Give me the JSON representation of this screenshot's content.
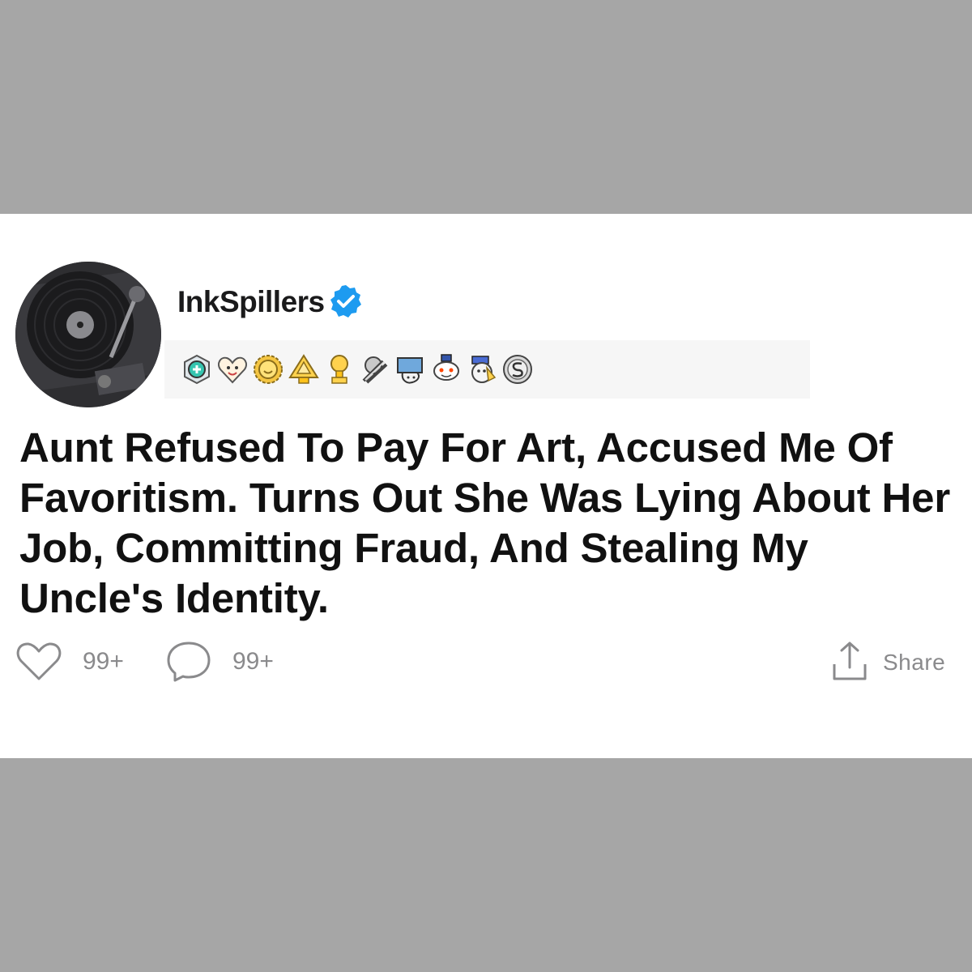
{
  "post": {
    "username": "InkSpillers",
    "verified": true,
    "title": "Aunt Refused To Pay For Art, Accused Me Of Favoritism. Turns Out She Was Lying About Her Job, Committing Fraud, And Stealing My Uncle's Identity.",
    "awards": [
      "helpful-award-icon",
      "wholesome-award-icon",
      "silver-sun-award-icon",
      "take-my-energy-award-icon",
      "gold-trophy-award-icon",
      "hugz-award-icon",
      "wholesome-seal-award-icon",
      "snoo-award-icon",
      "bravo-award-icon",
      "s-coin-award-icon"
    ]
  },
  "actions": {
    "likes": "99+",
    "comments": "99+",
    "share_label": "Share"
  },
  "colors": {
    "background": "#a6a6a6",
    "card": "#ffffff",
    "award_bar": "#f6f6f6",
    "verified": "#1d9bf0",
    "muted": "#8a8a8c",
    "text": "#111111"
  }
}
